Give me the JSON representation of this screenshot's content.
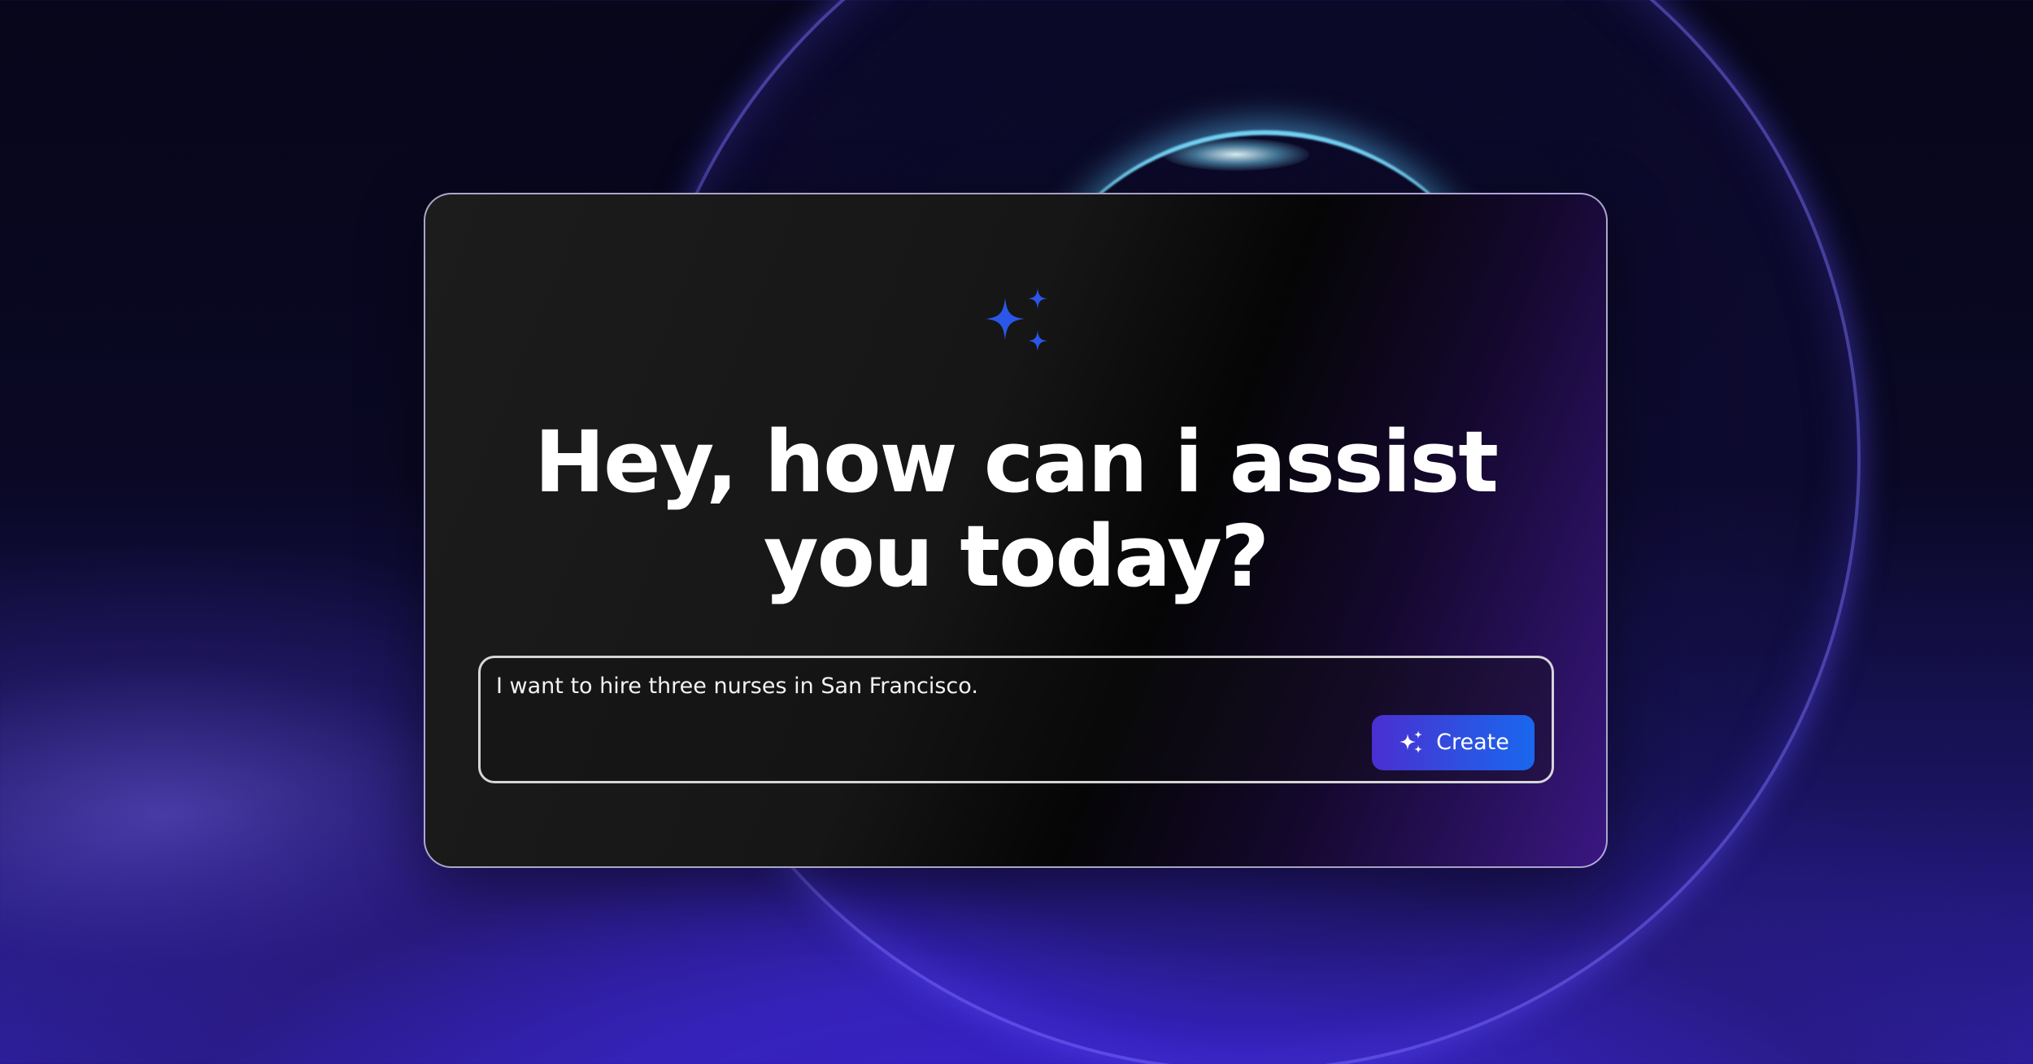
{
  "assistant": {
    "headline_line1": "Hey, how can i assist",
    "headline_line2": "you today?"
  },
  "prompt": {
    "value": "I want to hire three nurses in San Francisco."
  },
  "actions": {
    "create_label": "Create"
  },
  "icons": {
    "header": "sparkles-icon",
    "create_button": "sparkles-icon"
  },
  "colors": {
    "accent": "#2f4fe0",
    "sparkle": "#2a57e8",
    "button_gradient_start": "#4a2fd1",
    "button_gradient_end": "#1967ee"
  }
}
